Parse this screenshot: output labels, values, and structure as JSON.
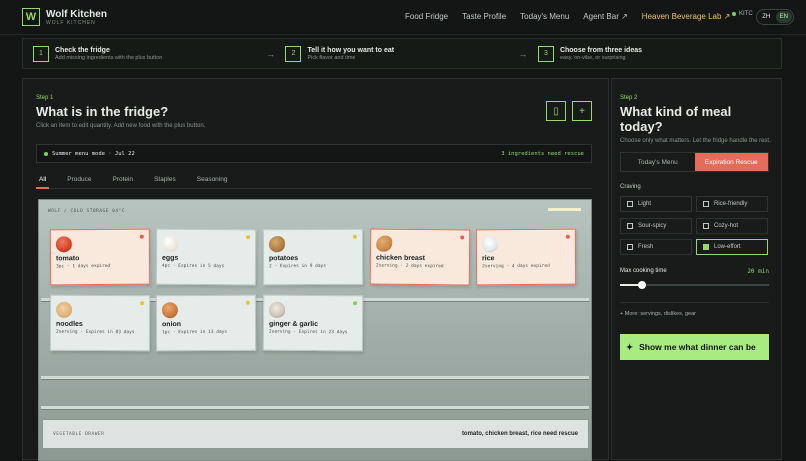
{
  "header": {
    "brand_name": "Wolf Kitchen",
    "brand_sub": "WOLF KITCHEN",
    "logo_letter": "W",
    "nav": [
      {
        "label": "Food Fridge"
      },
      {
        "label": "Taste Profile"
      },
      {
        "label": "Today's Menu"
      },
      {
        "label": "Agent Bar ↗"
      },
      {
        "label": "Heaven Beverage Lab ↗",
        "accent": "#e9c46a"
      }
    ],
    "status_label": "KITC",
    "lang": {
      "zh": "ZH",
      "en": "EN",
      "active": "EN"
    }
  },
  "steps": [
    {
      "num": "1",
      "title": "Check the fridge",
      "desc": "Add missing ingredients with the plus button"
    },
    {
      "num": "2",
      "title": "Tell it how you want to eat",
      "desc": "Pick flavor and time"
    },
    {
      "num": "3",
      "title": "Choose from three ideas",
      "desc": "easy, on-vibe, or surprising"
    }
  ],
  "fridge_panel": {
    "step_label": "Step 1",
    "title": "What is in the fridge?",
    "subtitle": "Click an item to edit quantity. Add new food with the plus button.",
    "banner_left": "Summer menu mode · Jul 22",
    "banner_right": "3 ingredients need rescue",
    "tabs": [
      "All",
      "Produce",
      "Protein",
      "Staples",
      "Seasoning"
    ],
    "active_tab": "All",
    "storage_label": "WOLF / COLD STORAGE 04°C",
    "drawer_label": "VEGETABLE DRAWER",
    "drawer_note": "tomato, chicken breast, rice need rescue",
    "items": [
      {
        "name": "tomato",
        "meta": "3pc · 1 days expired",
        "status": "expired",
        "icon": "tomato-icon",
        "color": "#d8402a"
      },
      {
        "name": "eggs",
        "meta": "4pc · Expires in 5 days",
        "status": "soon",
        "icon": "egg-icon",
        "color": "#f3efe8"
      },
      {
        "name": "potatoes",
        "meta": "2 · Expires in 9 days",
        "status": "soon",
        "icon": "potato-icon",
        "color": "#a97a3f"
      },
      {
        "name": "chicken breast",
        "meta": "2serving · 2 days expired",
        "status": "expired",
        "icon": "chicken-icon",
        "color": "#c98a4b"
      },
      {
        "name": "rice",
        "meta": "2serving · 4 days expired",
        "status": "expired",
        "icon": "rice-icon",
        "color": "#e4e6e6"
      },
      {
        "name": "noodles",
        "meta": "2serving · Expires in 83 days",
        "status": "soon",
        "icon": "noodles-icon",
        "color": "#e0b27a"
      },
      {
        "name": "onion",
        "meta": "1pc · Expires in 13 days",
        "status": "soon",
        "icon": "onion-icon",
        "color": "#c9793e"
      },
      {
        "name": "ginger & garlic",
        "meta": "2serving · Expires in 23 days",
        "status": "fresh",
        "icon": "garlic-icon",
        "color": "#cfc3b6"
      }
    ]
  },
  "meal_panel": {
    "step_label": "Step 2",
    "title": "What kind of meal today?",
    "subtitle": "Choose only what matters. Let the fridge handle the rest.",
    "modes": [
      "Today's Menu",
      "Expiration Rescue"
    ],
    "active_mode": "Expiration Rescue",
    "craving_label": "Craving",
    "cravings": [
      {
        "label": "Light",
        "checked": false
      },
      {
        "label": "Rice-friendly",
        "checked": false
      },
      {
        "label": "Sour-spicy",
        "checked": false
      },
      {
        "label": "Cozy-hot",
        "checked": false
      },
      {
        "label": "Fresh",
        "checked": false
      },
      {
        "label": "Low-effort",
        "checked": true
      }
    ],
    "cook_time_label": "Max cooking time",
    "cook_time_value": "20 min",
    "cook_time_fraction": 0.15,
    "more_label": "+ More: servings, dislikes, gear",
    "cta_label": "Show me what dinner can be",
    "cta_icon": "sparkle-icon"
  },
  "colors": {
    "accent": "#93d86b",
    "danger": "#e36d5a",
    "gold": "#e9c46a"
  }
}
